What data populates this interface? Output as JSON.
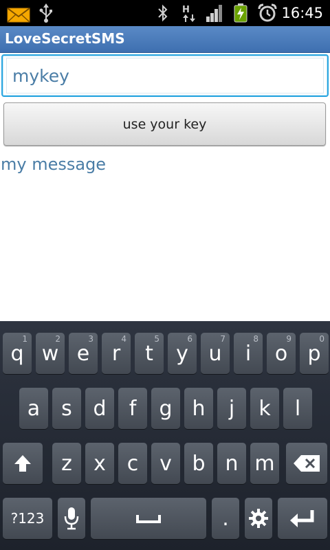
{
  "status_bar": {
    "time": "16:45",
    "icons": [
      "mail-icon",
      "usb-icon",
      "bluetooth-icon",
      "hsdpa-data-icon",
      "signal-icon",
      "battery-charging-icon",
      "alarm-icon"
    ]
  },
  "app": {
    "title": "LoveSecretSMS"
  },
  "main": {
    "key_input_value": "mykey",
    "use_key_label": "use your key",
    "message_label": "my message"
  },
  "keyboard": {
    "row1": [
      {
        "label": "q",
        "hint": "1"
      },
      {
        "label": "w",
        "hint": "2"
      },
      {
        "label": "e",
        "hint": "3"
      },
      {
        "label": "r",
        "hint": "4"
      },
      {
        "label": "t",
        "hint": "5"
      },
      {
        "label": "y",
        "hint": "6"
      },
      {
        "label": "u",
        "hint": "7"
      },
      {
        "label": "i",
        "hint": "8"
      },
      {
        "label": "o",
        "hint": "9"
      },
      {
        "label": "p",
        "hint": "0"
      }
    ],
    "row2": [
      "a",
      "s",
      "d",
      "f",
      "g",
      "h",
      "j",
      "k",
      "l"
    ],
    "row3": [
      "z",
      "x",
      "c",
      "v",
      "b",
      "n",
      "m"
    ],
    "symbols_label": "?123",
    "period_label": "."
  },
  "colors": {
    "accent": "#2aa6e0",
    "title_bar": "#4a7cbd",
    "text_blue": "#4a7da6"
  }
}
